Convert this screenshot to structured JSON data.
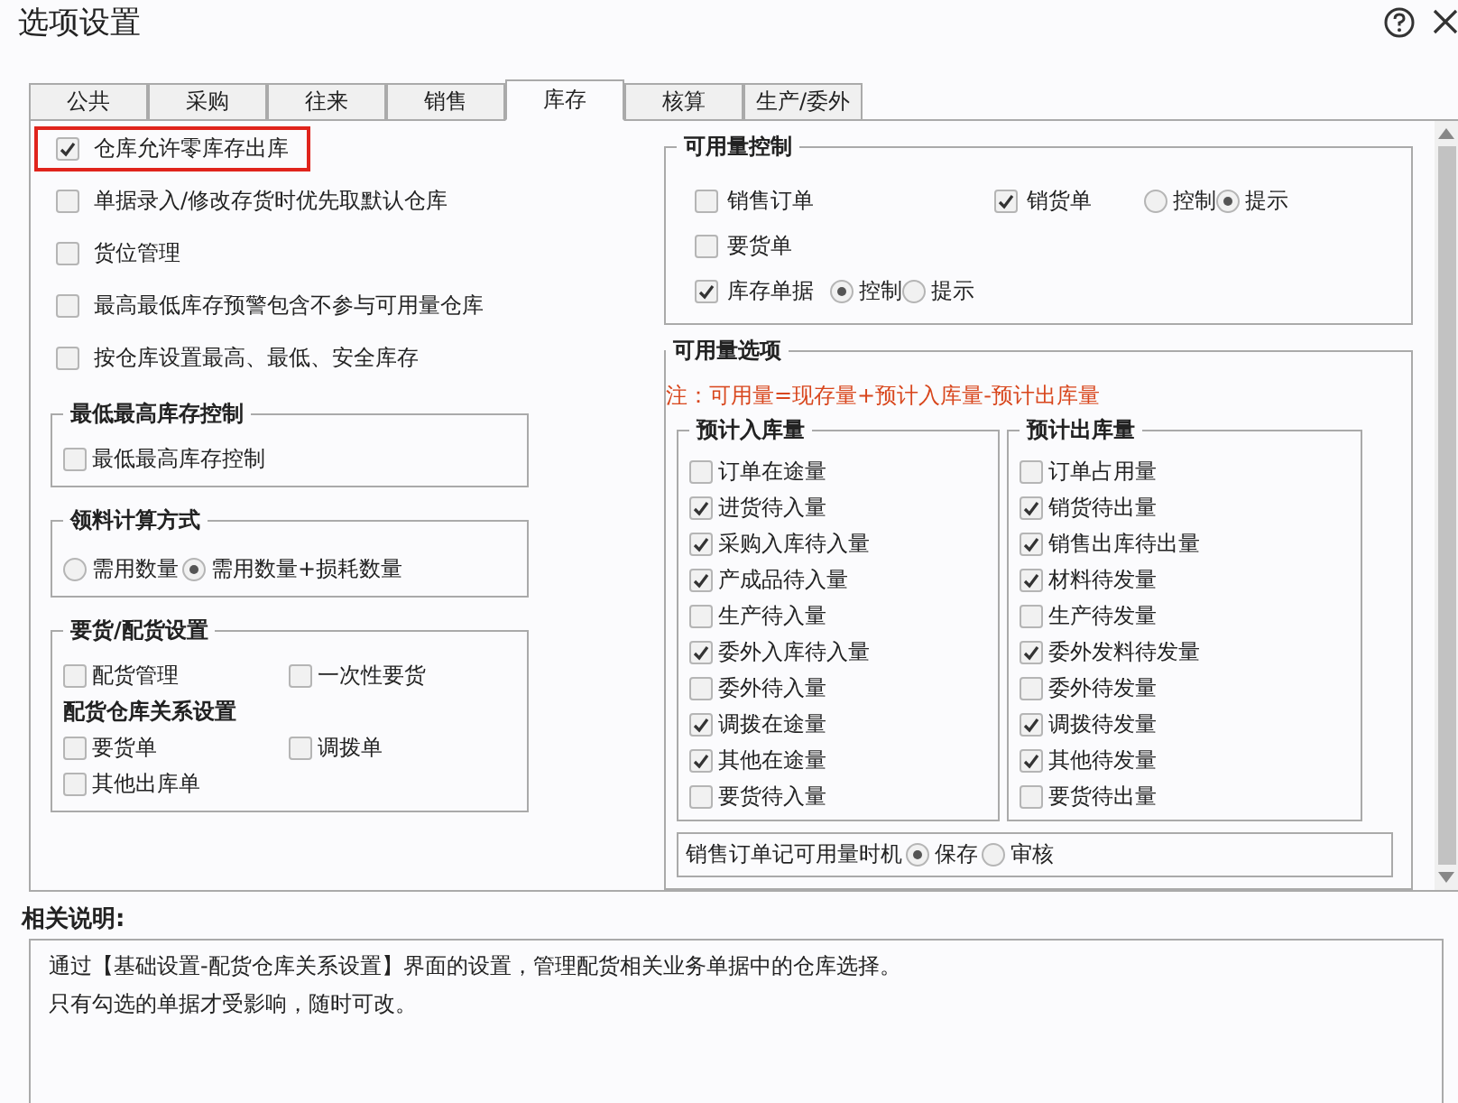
{
  "window": {
    "title": "选项设置"
  },
  "tabs": [
    {
      "label": "公共",
      "selected": false
    },
    {
      "label": "采购",
      "selected": false
    },
    {
      "label": "往来",
      "selected": false
    },
    {
      "label": "销售",
      "selected": false
    },
    {
      "label": "库存",
      "selected": true
    },
    {
      "label": "核算",
      "selected": false
    },
    {
      "label": "生产/委外",
      "selected": false
    }
  ],
  "general": {
    "options": [
      {
        "label": "仓库允许零库存出库",
        "checked": true,
        "highlighted": true
      },
      {
        "label": "单据录入/修改存货时优先取默认仓库",
        "checked": false,
        "highlighted": false
      },
      {
        "label": "货位管理",
        "checked": false,
        "highlighted": false
      },
      {
        "label": "最高最低库存预警包含不参与可用量仓库",
        "checked": false,
        "highlighted": false
      },
      {
        "label": "按仓库设置最高、最低、安全库存",
        "checked": false,
        "highlighted": false
      }
    ],
    "groups": [
      {
        "title": "最低最高库存控制",
        "kind": "list",
        "items": [
          {
            "kind": "checkbox",
            "label": "最低最高库存控制",
            "checked": false
          }
        ]
      },
      {
        "title": "领料计算方式",
        "kind": "inline",
        "items": [
          {
            "kind": "radio",
            "label": "需用数量",
            "selected": false
          },
          {
            "kind": "radio",
            "label": "需用数量+损耗数量",
            "selected": true
          }
        ]
      },
      {
        "title": "要货/配货设置",
        "kind": "grid",
        "items": [
          {
            "kind": "checkbox",
            "label": "配货管理",
            "checked": false
          },
          {
            "kind": "checkbox",
            "label": "一次性要货",
            "checked": false
          },
          {
            "kind": "heading",
            "label": "配货仓库关系设置"
          },
          {
            "kind": "checkbox",
            "label": "要货单",
            "checked": false
          },
          {
            "kind": "checkbox",
            "label": "调拨单",
            "checked": false
          },
          {
            "kind": "checkbox",
            "label": "其他出库单",
            "checked": false
          }
        ]
      }
    ]
  },
  "availability_control": {
    "title": "可用量控制",
    "controls": [
      {
        "label": "销售订单",
        "checked": false
      },
      {
        "label": "销货单",
        "checked": true,
        "modes": [
          {
            "label": "控制",
            "selected": false
          },
          {
            "label": "提示",
            "selected": true
          }
        ]
      },
      {
        "label": "要货单",
        "checked": false
      },
      {
        "label": "库存单据",
        "checked": true,
        "modes": [
          {
            "label": "控制",
            "selected": true
          },
          {
            "label": "提示",
            "selected": false
          }
        ]
      }
    ]
  },
  "availability_options": {
    "title": "可用量选项",
    "note": "注：可用量=现存量+预计入库量-预计出库量",
    "columns": [
      {
        "title": "预计入库量",
        "items": [
          {
            "label": "订单在途量",
            "checked": false
          },
          {
            "label": "进货待入量",
            "checked": true
          },
          {
            "label": "采购入库待入量",
            "checked": true
          },
          {
            "label": "产成品待入量",
            "checked": true
          },
          {
            "label": "生产待入量",
            "checked": false
          },
          {
            "label": "委外入库待入量",
            "checked": true
          },
          {
            "label": "委外待入量",
            "checked": false
          },
          {
            "label": "调拨在途量",
            "checked": true
          },
          {
            "label": "其他在途量",
            "checked": true
          },
          {
            "label": "要货待入量",
            "checked": false
          }
        ]
      },
      {
        "title": "预计出库量",
        "items": [
          {
            "label": "订单占用量",
            "checked": false
          },
          {
            "label": "销货待出量",
            "checked": true
          },
          {
            "label": "销售出库待出量",
            "checked": true
          },
          {
            "label": "材料待发量",
            "checked": true
          },
          {
            "label": "生产待发量",
            "checked": false
          },
          {
            "label": "委外发料待发量",
            "checked": true
          },
          {
            "label": "委外待发量",
            "checked": false
          },
          {
            "label": "调拨待发量",
            "checked": true
          },
          {
            "label": "其他待发量",
            "checked": true
          },
          {
            "label": "要货待出量",
            "checked": false
          }
        ]
      }
    ],
    "timing": {
      "label": "销售订单记可用量时机",
      "modes": [
        {
          "label": "保存",
          "selected": true
        },
        {
          "label": "审核",
          "selected": false
        }
      ]
    }
  },
  "description": {
    "title": "相关说明:",
    "lines": [
      "通过【基础设置-配货仓库关系设置】界面的设置，管理配货相关业务单据中的仓库选择。",
      "只有勾选的单据才受影响，随时可改。"
    ]
  }
}
